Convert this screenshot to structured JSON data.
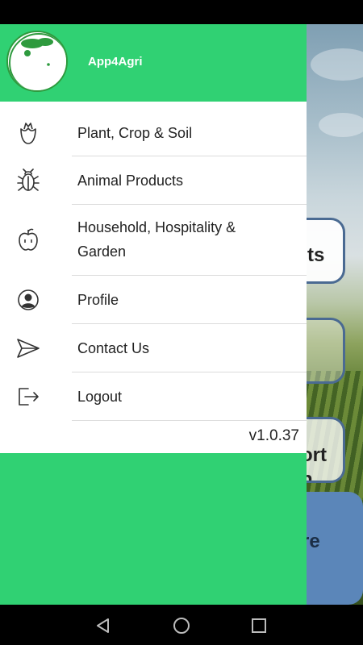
{
  "app": {
    "title": "App4Agri",
    "version": "v1.0.37"
  },
  "menu": {
    "items": [
      {
        "label": "Plant, Crop & Soil",
        "icon": "flower-bud-icon"
      },
      {
        "label": "Animal Products",
        "icon": "bug-icon"
      },
      {
        "label": "Household, Hospitality & Garden",
        "icon": "apple-icon"
      },
      {
        "label": "Profile",
        "icon": "user-circle-icon"
      },
      {
        "label": "Contact Us",
        "icon": "send-icon"
      },
      {
        "label": "Logout",
        "icon": "logout-icon"
      }
    ]
  },
  "background": {
    "cards": [
      "ts",
      "",
      "ort\nn",
      "re"
    ]
  },
  "colors": {
    "accent": "#30d173",
    "drawer_bg": "#ffffff",
    "text": "#222222",
    "card_border": "#4a6a92"
  },
  "nav": {
    "buttons": [
      "back-icon",
      "home-icon",
      "recents-icon"
    ]
  }
}
